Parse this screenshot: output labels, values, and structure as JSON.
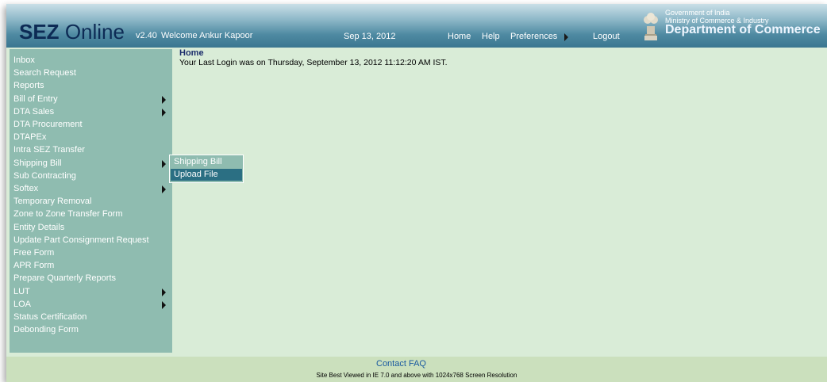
{
  "header": {
    "brand_sez": "SEZ",
    "brand_online": "Online",
    "version": "v2.40",
    "welcome": "Welcome Ankur Kapoor",
    "date": "Sep 13, 2012",
    "nav": {
      "home": "Home",
      "help": "Help",
      "preferences": "Preferences",
      "logout": "Logout"
    },
    "gov_line1": "Government of India",
    "gov_line2": "Ministry of Commerce & Industry",
    "gov_line3": "Department of Commerce"
  },
  "sidebar": {
    "items": [
      {
        "label": "Inbox",
        "has_submenu": false
      },
      {
        "label": "Search Request",
        "has_submenu": false
      },
      {
        "label": "Reports",
        "has_submenu": false
      },
      {
        "label": "Bill of Entry",
        "has_submenu": true
      },
      {
        "label": "DTA Sales",
        "has_submenu": true
      },
      {
        "label": "DTA Procurement",
        "has_submenu": false
      },
      {
        "label": "DTAPEx",
        "has_submenu": false
      },
      {
        "label": "Intra SEZ Transfer",
        "has_submenu": false
      },
      {
        "label": "Shipping Bill",
        "has_submenu": true
      },
      {
        "label": "Sub Contracting",
        "has_submenu": false
      },
      {
        "label": "Softex",
        "has_submenu": true
      },
      {
        "label": "Temporary Removal",
        "has_submenu": false
      },
      {
        "label": "Zone to Zone Transfer Form",
        "has_submenu": false
      },
      {
        "label": "Entity Details",
        "has_submenu": false
      },
      {
        "label": "Update Part Consignment Request",
        "has_submenu": false
      },
      {
        "label": "Free Form",
        "has_submenu": false
      },
      {
        "label": "APR Form",
        "has_submenu": false
      },
      {
        "label": "Prepare Quarterly Reports",
        "has_submenu": false
      },
      {
        "label": "LUT",
        "has_submenu": true
      },
      {
        "label": "LOA",
        "has_submenu": true
      },
      {
        "label": "Status Certification",
        "has_submenu": false
      },
      {
        "label": "Debonding Form",
        "has_submenu": false
      }
    ]
  },
  "submenu": {
    "items": [
      {
        "label": "Shipping Bill",
        "selected": false
      },
      {
        "label": "Upload File",
        "selected": true
      }
    ]
  },
  "main": {
    "title": "Home",
    "last_login": "Your Last Login was on Thursday, September 13, 2012 11:12:20 AM IST."
  },
  "footer": {
    "contact": "Contact",
    "faq": "FAQ",
    "note": "Site Best Viewed in IE 7.0 and above with 1024x768 Screen Resolution"
  },
  "colors": {
    "sidebar_bg": "#8fbcb0",
    "content_bg": "#d9ecd7",
    "submenu_selected": "#2b6f83",
    "brand_text": "#0d2b55"
  }
}
